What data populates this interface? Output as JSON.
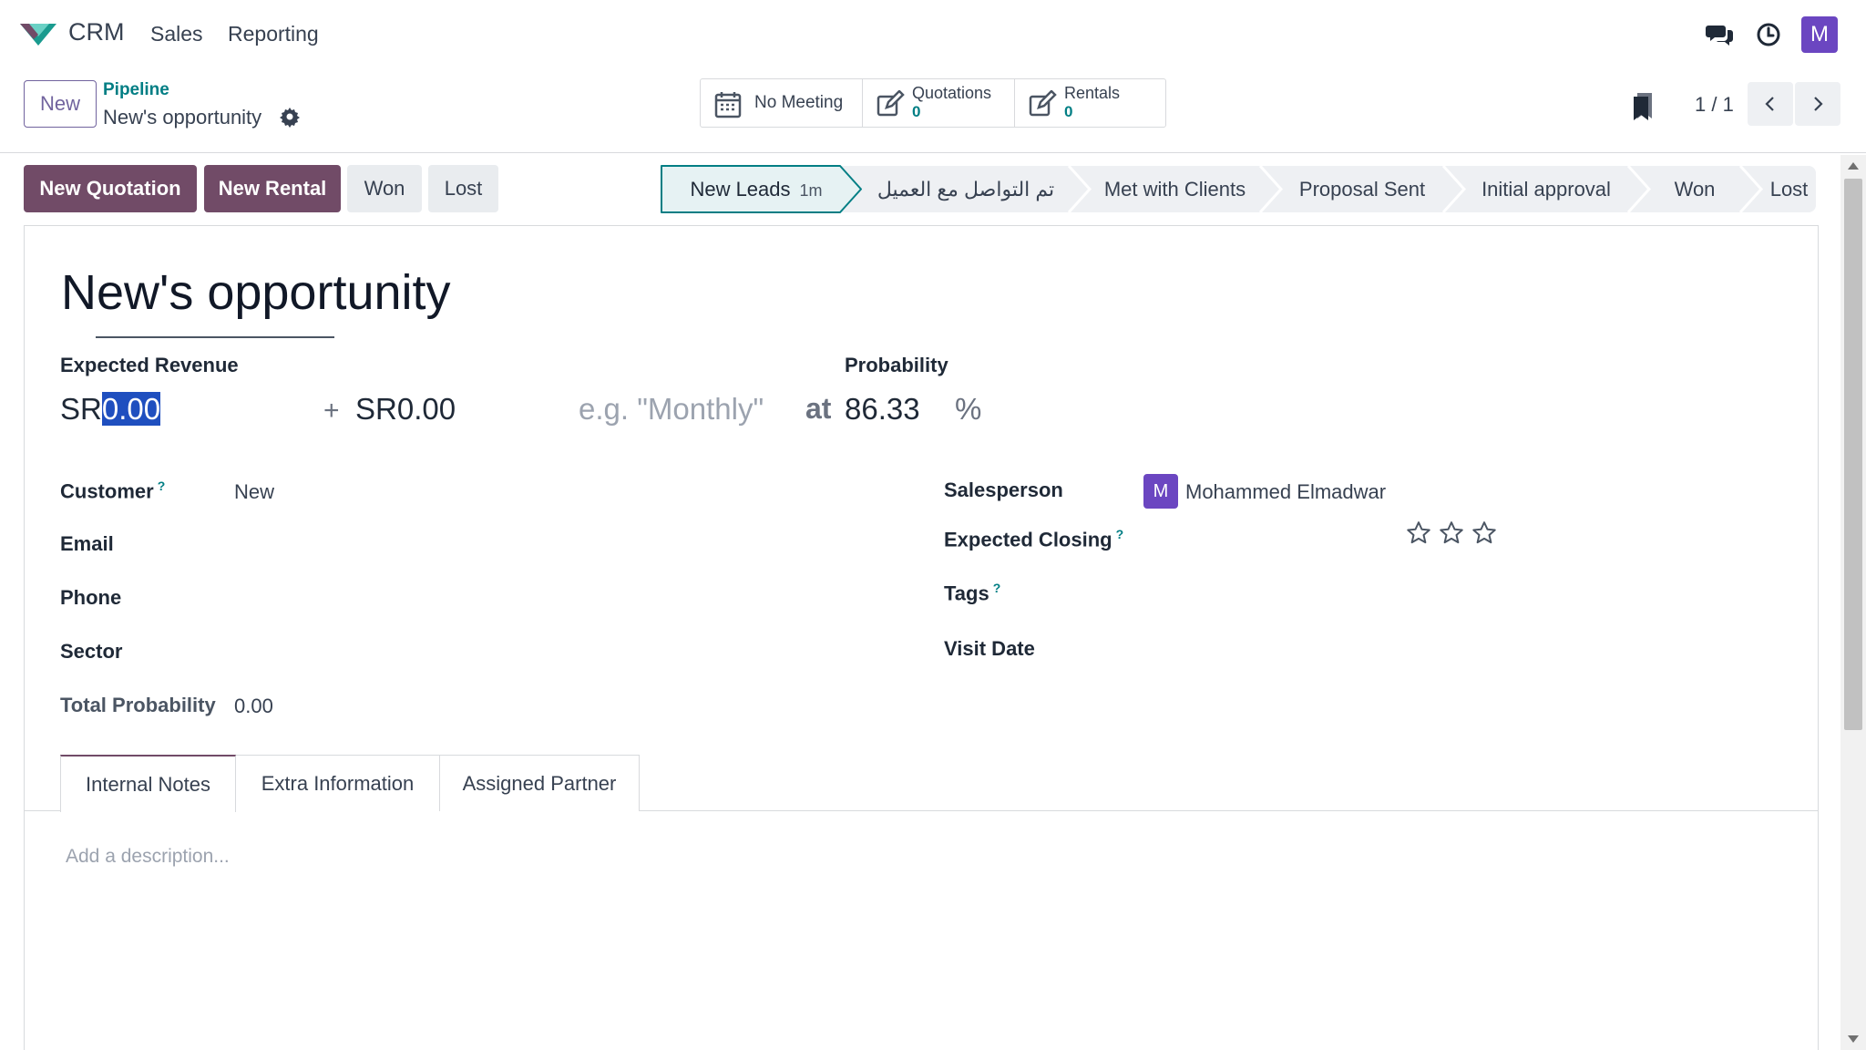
{
  "nav": {
    "app_name": "CRM",
    "menu": [
      "Sales",
      "Reporting"
    ],
    "user_initial": "M"
  },
  "control": {
    "new_label": "New",
    "breadcrumb_parent": "Pipeline",
    "breadcrumb_current": "New's opportunity",
    "smart_buttons": {
      "meeting": "No Meeting",
      "quotations_label": "Quotations",
      "quotations_count": "0",
      "rentals_label": "Rentals",
      "rentals_count": "0"
    },
    "pager": "1 / 1"
  },
  "actions": {
    "new_quotation": "New Quotation",
    "new_rental": "New Rental",
    "won": "Won",
    "lost": "Lost"
  },
  "stages": {
    "items": [
      "New Leads",
      "تم التواصل مع العميل",
      "Met with Clients",
      "Proposal Sent",
      "Initial approval",
      "Won",
      "Lost"
    ],
    "active_index": 0,
    "active_duration": "1m"
  },
  "form": {
    "title": "New's opportunity",
    "expected_revenue_label": "Expected Revenue",
    "currency": "SR",
    "expected_revenue_value": "0.00",
    "plus": "+",
    "recurring_currency": "SR",
    "recurring_value": "0.00",
    "recurring_plan_placeholder": "e.g. \"Monthly\"",
    "at": "at",
    "probability_label": "Probability",
    "probability_value": "86.33",
    "percent": "%",
    "left_fields": {
      "customer_label": "Customer",
      "customer_value": "New",
      "email_label": "Email",
      "phone_label": "Phone",
      "sector_label": "Sector",
      "total_probability_label": "Total Probability",
      "total_probability_value": "0.00"
    },
    "right_fields": {
      "salesperson_label": "Salesperson",
      "salesperson_initial": "M",
      "salesperson_value": "Mohammed Elmadwar",
      "expected_closing_label": "Expected Closing",
      "priority_stars": 0,
      "tags_label": "Tags",
      "visit_date_label": "Visit Date"
    },
    "help_mark": "?"
  },
  "tabs": {
    "items": [
      "Internal Notes",
      "Extra Information",
      "Assigned Partner"
    ],
    "active_index": 0
  },
  "notes": {
    "placeholder": "Add a description..."
  },
  "colors": {
    "brand": "#714b67",
    "accent_teal": "#017e84",
    "avatar": "#6b46c1"
  }
}
